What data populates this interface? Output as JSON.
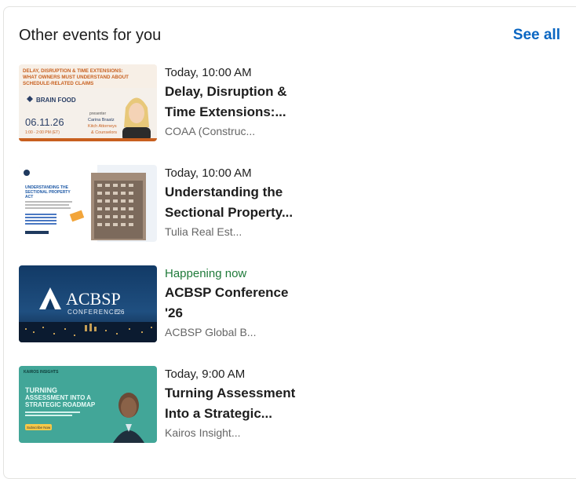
{
  "section": {
    "title": "Other events for you",
    "see_all": "See all"
  },
  "events": [
    {
      "time": "Today, 10:00 AM",
      "title_line1": "Delay, Disruption &",
      "title_line2": "Time Extensions:...",
      "organizer": "COAA (Construc...",
      "thumb": {
        "headline": "DELAY, DISRUPTION & TIME EXTENSIONS:",
        "headline2": "WHAT OWNERS MUST UNDERSTAND ABOUT",
        "headline3": "SCHEDULE-RELATED CLAIMS",
        "brand": "BRAIN FOOD",
        "date": "06.11.26",
        "hours": "1:00 - 2:00 PM (ET)",
        "presenter_label": "presenter",
        "presenter": "Carina Braatz",
        "firm": "Kitch Attorneys",
        "firm2": "& Counselors"
      }
    },
    {
      "time": "Today, 10:00 AM",
      "title_line1": "Understanding the",
      "title_line2": "Sectional Property...",
      "organizer": "Tulia Real Est...",
      "thumb": {
        "headline": "UNDERSTANDING THE",
        "headline2": "SECTIONAL PROPERTY",
        "headline3": "ACT"
      }
    },
    {
      "time": "Happening now",
      "title_line1": "ACBSP Conference",
      "title_line2": "'26",
      "organizer": "ACBSP Global B...",
      "thumb": {
        "brand": "ACBSP",
        "sub": "CONFERENCE",
        "year": "'26"
      }
    },
    {
      "time": "Today, 9:00 AM",
      "title_line1": "Turning Assessment",
      "title_line2": "Into a Strategic...",
      "organizer": "Kairos Insight...",
      "thumb": {
        "brand": "KAIROS INSIGHTS",
        "headline": "TURNING",
        "headline2": "ASSESSMENT INTO A",
        "headline3": "STRATEGIC ROADMAP",
        "button": "Subscribe Now"
      }
    }
  ],
  "colors": {
    "accent": "#0a66c2",
    "live": "#1f7a3a"
  }
}
